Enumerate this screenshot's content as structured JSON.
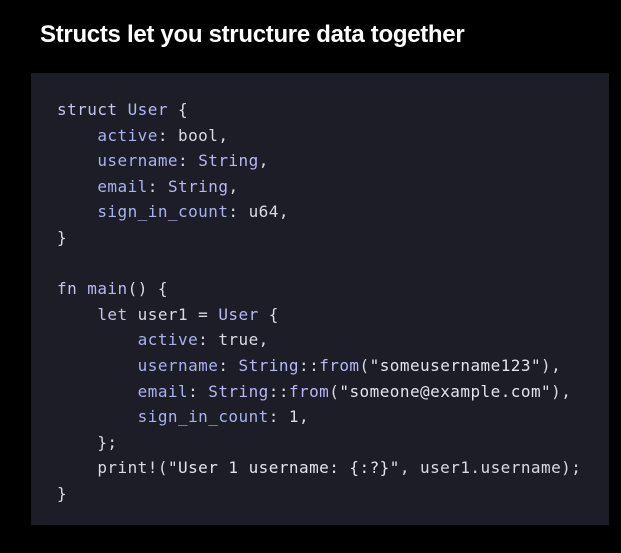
{
  "slide": {
    "title": "Structs let you structure data together"
  },
  "code": {
    "language": "rust",
    "lines": [
      {
        "indent": 0,
        "tokens": [
          {
            "t": "struct",
            "k": "kw"
          },
          {
            "t": " ",
            "k": "plain"
          },
          {
            "t": "User",
            "k": "ty"
          },
          {
            "t": " {",
            "k": "pun"
          }
        ]
      },
      {
        "indent": 1,
        "tokens": [
          {
            "t": "active",
            "k": "fld"
          },
          {
            "t": ": bool,",
            "k": "plain"
          }
        ]
      },
      {
        "indent": 1,
        "tokens": [
          {
            "t": "username",
            "k": "fld"
          },
          {
            "t": ": ",
            "k": "plain"
          },
          {
            "t": "String",
            "k": "ty"
          },
          {
            "t": ",",
            "k": "pun"
          }
        ]
      },
      {
        "indent": 1,
        "tokens": [
          {
            "t": "email",
            "k": "fld"
          },
          {
            "t": ": ",
            "k": "plain"
          },
          {
            "t": "String",
            "k": "ty"
          },
          {
            "t": ",",
            "k": "pun"
          }
        ]
      },
      {
        "indent": 1,
        "tokens": [
          {
            "t": "sign_in_count",
            "k": "fld"
          },
          {
            "t": ": u64,",
            "k": "plain"
          }
        ]
      },
      {
        "indent": 0,
        "tokens": [
          {
            "t": "}",
            "k": "pun"
          }
        ]
      },
      {
        "indent": 0,
        "tokens": []
      },
      {
        "indent": 0,
        "tokens": [
          {
            "t": "fn",
            "k": "kw"
          },
          {
            "t": " ",
            "k": "plain"
          },
          {
            "t": "main",
            "k": "fn"
          },
          {
            "t": "() {",
            "k": "pun"
          }
        ]
      },
      {
        "indent": 1,
        "tokens": [
          {
            "t": "let",
            "k": "kw"
          },
          {
            "t": " user1 = ",
            "k": "plain"
          },
          {
            "t": "User",
            "k": "ty"
          },
          {
            "t": " {",
            "k": "pun"
          }
        ]
      },
      {
        "indent": 2,
        "tokens": [
          {
            "t": "active",
            "k": "fld"
          },
          {
            "t": ": true,",
            "k": "plain"
          }
        ]
      },
      {
        "indent": 2,
        "tokens": [
          {
            "t": "username",
            "k": "fld"
          },
          {
            "t": ": ",
            "k": "plain"
          },
          {
            "t": "String",
            "k": "ty"
          },
          {
            "t": "::",
            "k": "pun"
          },
          {
            "t": "from",
            "k": "fn"
          },
          {
            "t": "(",
            "k": "pun"
          },
          {
            "t": "\"someusername123\"",
            "k": "str"
          },
          {
            "t": "),",
            "k": "pun"
          }
        ]
      },
      {
        "indent": 2,
        "tokens": [
          {
            "t": "email",
            "k": "fld"
          },
          {
            "t": ": ",
            "k": "plain"
          },
          {
            "t": "String",
            "k": "ty"
          },
          {
            "t": "::",
            "k": "pun"
          },
          {
            "t": "from",
            "k": "fn"
          },
          {
            "t": "(",
            "k": "pun"
          },
          {
            "t": "\"someone@example.com\"",
            "k": "str"
          },
          {
            "t": "),",
            "k": "pun"
          }
        ]
      },
      {
        "indent": 2,
        "tokens": [
          {
            "t": "sign_in_count",
            "k": "fld"
          },
          {
            "t": ": 1,",
            "k": "plain"
          }
        ]
      },
      {
        "indent": 1,
        "tokens": [
          {
            "t": "};",
            "k": "pun"
          }
        ]
      },
      {
        "indent": 1,
        "tokens": [
          {
            "t": "print!",
            "k": "plain"
          },
          {
            "t": "(",
            "k": "pun"
          },
          {
            "t": "\"User 1 username: {:?}\"",
            "k": "str"
          },
          {
            "t": ", user1.username);",
            "k": "plain"
          }
        ]
      },
      {
        "indent": 0,
        "tokens": [
          {
            "t": "}",
            "k": "pun"
          }
        ]
      }
    ]
  },
  "colors": {
    "page_background": "#000000",
    "panel_background": "#1c1d26",
    "title_text": "#ffffff",
    "code_text": "#d8dae4",
    "keyword": "#c2c6e8",
    "type": "#b7b8f5",
    "field": "#a9b2f0"
  }
}
